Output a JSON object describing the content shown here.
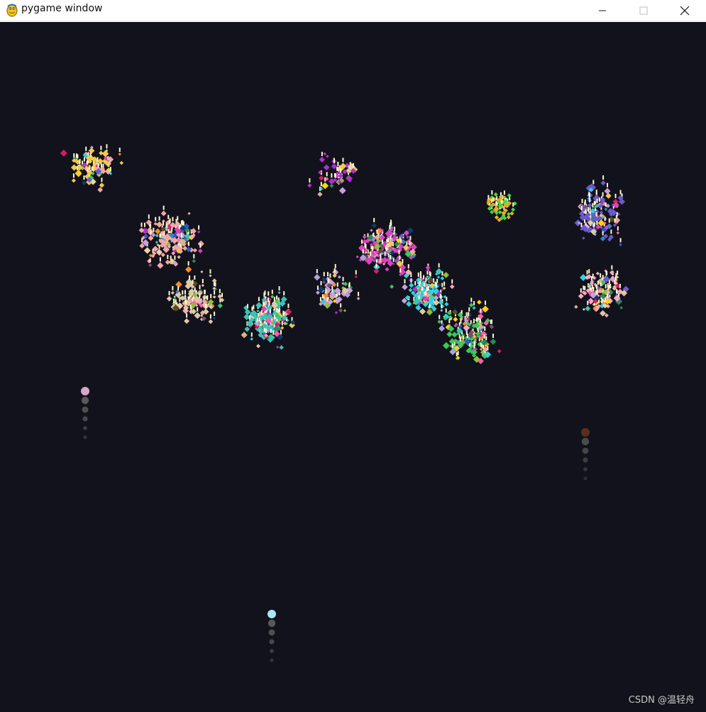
{
  "window": {
    "title": "pygame window",
    "icon": "pygame-snake-icon",
    "controls": {
      "minimize_icon": "minimize-icon",
      "maximize_icon": "maximize-icon",
      "close_icon": "close-icon"
    }
  },
  "canvas": {
    "background": "#12121c",
    "watermark": "CSDN @温轻舟"
  },
  "palette": [
    "#f2c94c",
    "#f4a6a6",
    "#e0c9a6",
    "#36c5b5",
    "#b02fd0",
    "#e040c0",
    "#2ed3e0",
    "#3cc85a",
    "#6a5acd",
    "#f7a9c0",
    "#c9a0dc",
    "#8fbf3f",
    "#d9b38c",
    "#5c4a2a",
    "#0a3b6b",
    "#e8d5a3",
    "#3355cc",
    "#d81b60",
    "#1f8f4f",
    "#7a4b6e",
    "#f28c28",
    "#ffd700",
    "#ff5faf",
    "#3f7fbf",
    "#b0a0e0"
  ],
  "rockets": [
    {
      "color": "#d6a7c8",
      "trail": "#6a6a6a"
    },
    {
      "color": "#5a2e1e",
      "trail": "#5a5a5a"
    },
    {
      "color": "#a8e8f0",
      "trail": "#6a6a6a"
    }
  ]
}
